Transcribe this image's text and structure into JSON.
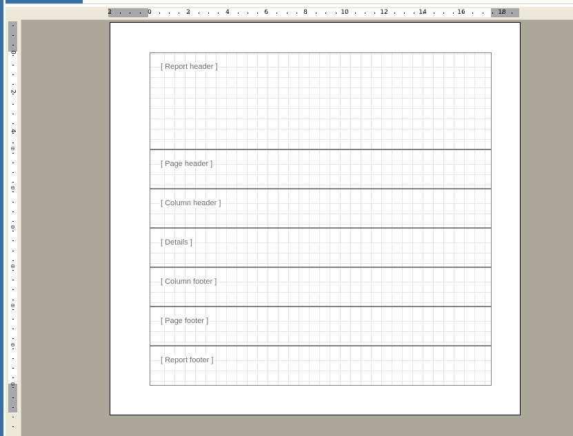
{
  "ruler_top": {
    "labels": [
      "2",
      "0",
      "2",
      "4",
      "6",
      "8",
      "10",
      "12",
      "14",
      "16",
      "18"
    ]
  },
  "ruler_left": {
    "labels": [
      "0",
      "2",
      "4"
    ]
  },
  "bands": [
    {
      "label": "[ Report header ]"
    },
    {
      "label": "[ Page header ]"
    },
    {
      "label": "[ Column header ]"
    },
    {
      "label": "[ Details ]"
    },
    {
      "label": "[ Column footer ]"
    },
    {
      "label": "[ Page footer ]"
    },
    {
      "label": "[ Report footer ]"
    }
  ],
  "colors": {
    "workspace": "#aca899",
    "ruler": "#ece9d8",
    "band_border": "#808080",
    "label_text": "#6d6d6d"
  }
}
